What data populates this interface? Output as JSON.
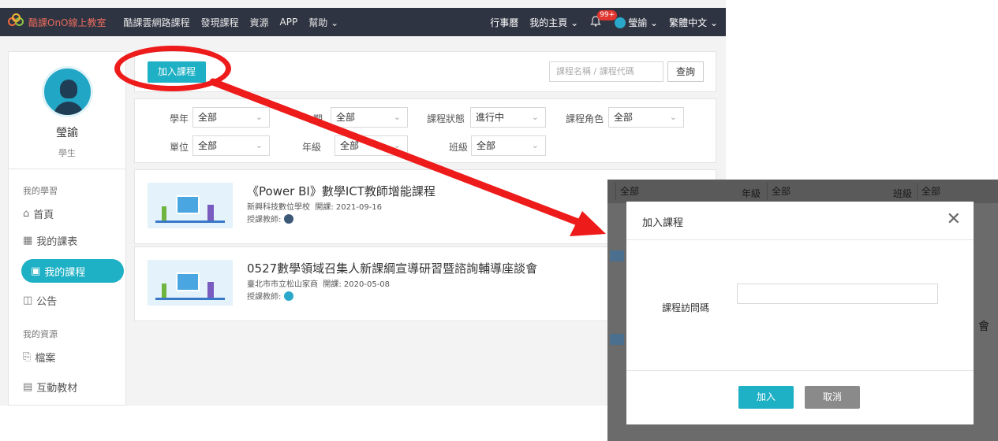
{
  "topnav": {
    "logo_text": "酷課OnO線上教室",
    "links": [
      "酷課雲網路課程",
      "發現課程",
      "資源",
      "APP",
      "幫助"
    ],
    "calendar": "行事曆",
    "my_home": "我的主頁",
    "badge": "99+",
    "user": "瑩諭",
    "language": "繁體中文"
  },
  "sidebar": {
    "name": "瑩諭",
    "role": "學生",
    "section_learning": "我的學習",
    "items_learning": [
      "首頁",
      "我的課表",
      "我的課程",
      "公告"
    ],
    "section_resources": "我的資源",
    "items_resources": [
      "檔案",
      "互動教材"
    ]
  },
  "toolbar": {
    "join_label": "加入課程",
    "search_placeholder": "課程名稱 / 課程代碼",
    "search_button": "查詢"
  },
  "filters": {
    "year_label": "學年",
    "year_value": "全部",
    "term_label": "期",
    "term_value": "全部",
    "status_label": "課程狀態",
    "status_value": "進行中",
    "role_label": "課程角色",
    "role_value": "全部",
    "unit_label": "單位",
    "unit_value": "全部",
    "grade_label": "年級",
    "grade_value": "全部",
    "class_label": "班級",
    "class_value": "全部"
  },
  "courses": [
    {
      "title": "《Power BI》數學ICT教師增能課程",
      "school": "新興科技數位學校",
      "start": "開課: 2021-09-16",
      "teacher_label": "授課教師:"
    },
    {
      "title": "0527數學領域召集人新課綱宣導研習暨諮詢輔導座談會",
      "school": "臺北市市立松山家商",
      "start": "開課: 2020-05-08",
      "teacher_label": "授課教師:"
    }
  ],
  "overlay_bg": {
    "unit_value": "全部",
    "grade_label": "年級",
    "grade_value": "全部",
    "class_label": "班級",
    "class_value": "全部",
    "side_char": "會"
  },
  "modal": {
    "title": "加入課程",
    "field_label": "課程訪問碼",
    "confirm_label": "加入",
    "cancel_label": "取消"
  },
  "colors": {
    "accent": "#1eb0c4",
    "nav_bg": "#2f3442",
    "annotation": "#ee1b1b"
  }
}
